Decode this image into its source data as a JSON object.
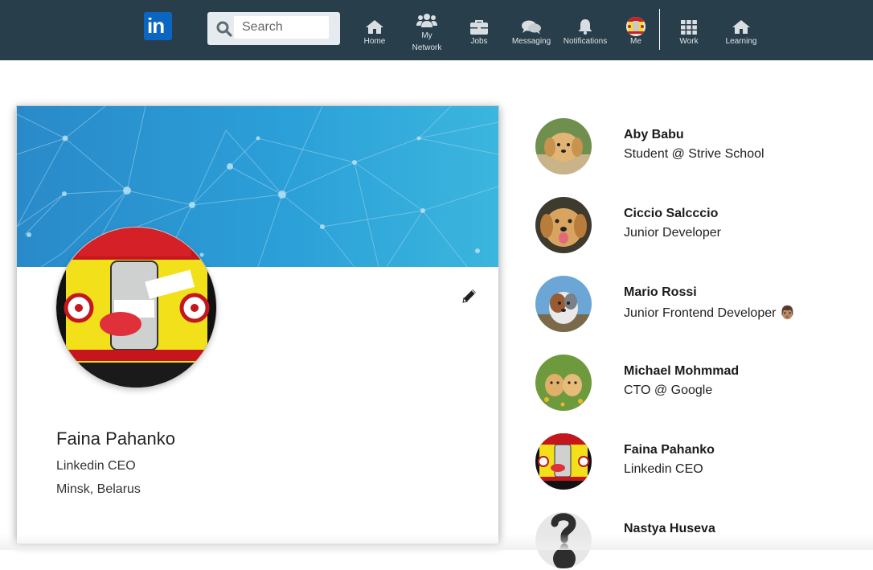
{
  "nav": {
    "logo_text": "in",
    "search_placeholder": "Search",
    "items": [
      {
        "label": "Home",
        "icon": "home-icon"
      },
      {
        "label": "My\nNetwork",
        "icon": "people-icon"
      },
      {
        "label": "Jobs",
        "icon": "briefcase-icon"
      },
      {
        "label": "Messaging",
        "icon": "chat-icon"
      },
      {
        "label": "Notifications",
        "icon": "bell-icon"
      },
      {
        "label": "Me",
        "icon": "avatar"
      },
      {
        "label": "Work",
        "icon": "grid-icon"
      },
      {
        "label": "Learning",
        "icon": "home-icon"
      }
    ]
  },
  "profile": {
    "name": "Faina Pahanko",
    "title": "Linkedin CEO",
    "location": "Minsk, Belarus"
  },
  "people": [
    {
      "name": "Aby Babu",
      "title": "Student @ Strive School",
      "avatar": "golden-puppy"
    },
    {
      "name": "Ciccio Salcccio",
      "title": "Junior Developer",
      "avatar": "golden-retriever"
    },
    {
      "name": "Mario Rossi",
      "title": "Junior Frontend Developer 👨🏽",
      "avatar": "australian-shepherd"
    },
    {
      "name": "Michael Mohmmad",
      "title": "CTO @ Google",
      "avatar": "two-puppies"
    },
    {
      "name": "Faina Pahanko",
      "title": "Linkedin CEO",
      "avatar": "ubik-spray"
    },
    {
      "name": "Nastya Huseva",
      "title": "",
      "avatar": "question-mark"
    }
  ],
  "colors": {
    "nav_bg": "#283e4a",
    "brand": "#0a66c2",
    "banner": "#2b9fd8"
  }
}
